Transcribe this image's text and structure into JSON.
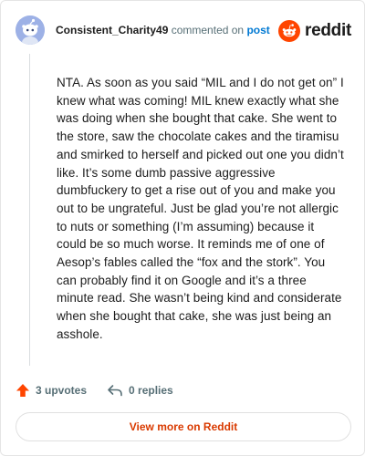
{
  "header": {
    "author": "Consistent_Charity49",
    "action_text": "commented on",
    "post_link": "post",
    "brand": "reddit"
  },
  "comment": {
    "body": "NTA. As soon as you said “MIL and I do not get on” I knew what was coming! MIL knew exactly what she was doing when she bought that cake. She went to the store, saw the chocolate cakes and the tiramisu and smirked to herself and picked out one you didn’t like. It’s some dumb passive aggressive dumbfuckery to get a rise out of you and make you out to be ungrateful. Just be glad you’re not allergic to nuts or something (I’m assuming) because it could be so much worse. It reminds me of one of Aesop’s fables called the “fox and the stork”. You can probably find it on Google and it’s a three minute read. She wasn’t being kind and considerate when she bought that cake, she was just being an asshole."
  },
  "footer": {
    "upvotes": "3 upvotes",
    "replies": "0 replies"
  },
  "view_more": "View more on Reddit",
  "icons": {
    "avatar": "snoo-avatar-icon",
    "logo": "reddit-logo-icon",
    "upvote": "upvote-arrow-icon",
    "reply": "reply-arrow-icon"
  },
  "colors": {
    "accent": "#ff4500",
    "link": "#0079d3",
    "view_more_text": "#d93a00",
    "muted": "#576f76",
    "avatar_bg": "#9db1e6"
  }
}
